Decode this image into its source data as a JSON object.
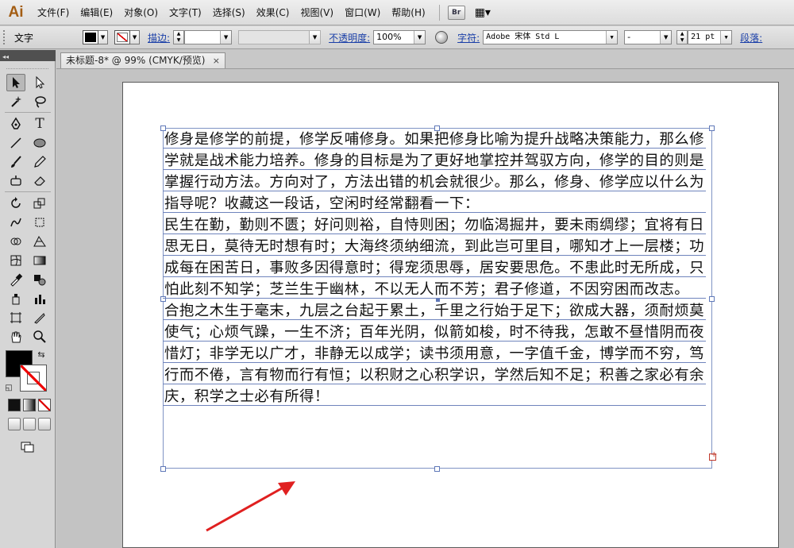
{
  "app": {
    "logo": "Ai"
  },
  "menu": {
    "items": [
      "文件(F)",
      "编辑(E)",
      "对象(O)",
      "文字(T)",
      "选择(S)",
      "效果(C)",
      "视图(V)",
      "窗口(W)",
      "帮助(H)"
    ],
    "bridge_label": "Br",
    "arrange_label": "▦▾"
  },
  "control": {
    "type_label": "文字",
    "stroke_label": "描边:",
    "stroke_value": "",
    "opacity_label": "不透明度:",
    "opacity_value": "100%",
    "char_label": "字符:",
    "font_family": "Adobe 宋体 Std L",
    "font_style": "-",
    "font_size": "21 pt",
    "para_label": "段落:"
  },
  "document": {
    "tab_title": "未标题-8* @ 99% (CMYK/预览)",
    "close_glyph": "×"
  },
  "text_content": {
    "paragraphs": [
      "修身是修学的前提，修学反哺修身。如果把修身比喻为提升战略决策能力，那么修学就是战术能力培养。修身的目标是为了更好地掌控并驾驭方向，修学的目的则是掌握行动方法。方向对了，方法出错的机会就很少。那么，修身、修学应以什么为指导呢？收藏这一段话，空闲时经常翻看一下：",
      "民生在勤，勤则不匮；好问则裕，自恃则困；勿临渴掘井，要未雨绸缪；宜将有日思无日，莫待无时想有时；大海终须纳细流，到此岂可里目，哪知才上一层楼；功成每在困苦日，事败多因得意时；得宠须思辱，居安要思危。不患此时无所成，只怕此刻不知学；芝兰生于幽林，不以无人而不芳；君子修道，不因穷困而改志。",
      "合抱之木生于毫末，九层之台起于累土，千里之行始于足下；欲成大器，须耐烦莫使气；心烦气躁，一生不济；百年光阴，似箭如梭，时不待我，怎敢不昼惜阴而夜惜灯；非学无以广才，非静无以成学；读书须用意，一字值千金，博学而不穷，笃行而不倦，言有物而行有恒；以积财之心积学识，学然后知不足；积善之家必有余庆，积学之士必有所得！"
    ]
  },
  "colors": {
    "accent_link": "#1a3fa8",
    "selection": "#6f84bc",
    "arrow": "#e02020",
    "ai_logo": "#a35d13"
  }
}
